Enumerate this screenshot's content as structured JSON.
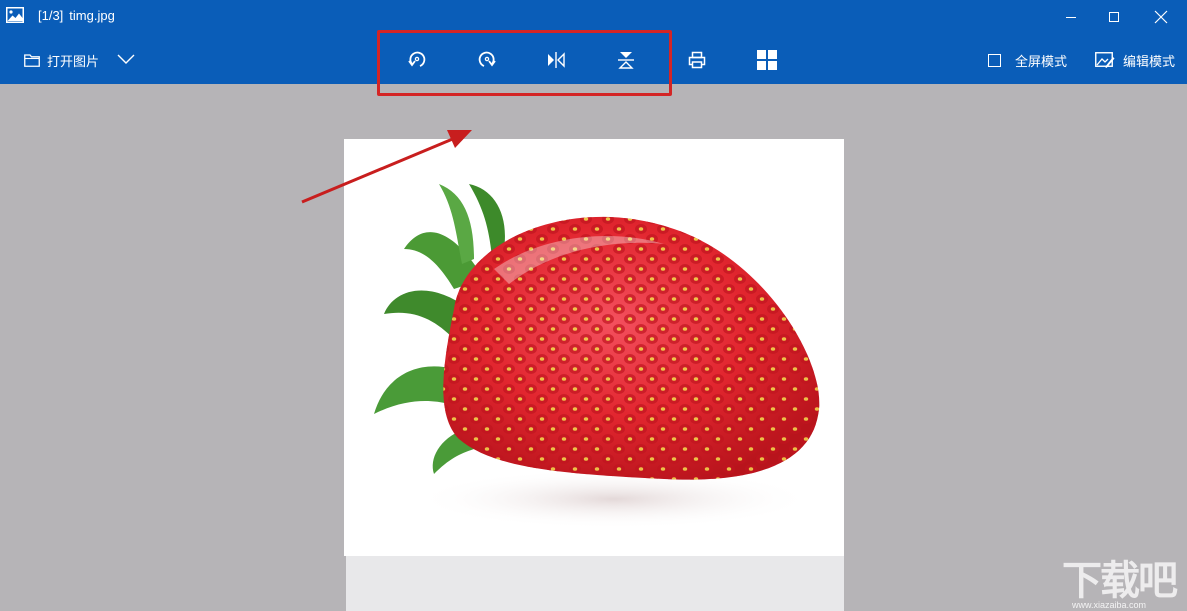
{
  "window": {
    "counter": "[1/3]",
    "filename": "timg.jpg"
  },
  "toolbar": {
    "open_label": "打开图片",
    "tools": [
      "rotate-left-icon",
      "rotate-right-icon",
      "flip-horizontal-icon",
      "flip-vertical-icon",
      "print-icon",
      "grid-icon"
    ],
    "fullscreen_label": "全屏模式",
    "edit_label": "编辑模式"
  },
  "watermark": {
    "text": "下载吧",
    "url": "www.xiazaiba.com"
  },
  "colors": {
    "titlebar": "#0a5db8",
    "canvas": "#b6b4b7",
    "highlight": "#d42525"
  }
}
